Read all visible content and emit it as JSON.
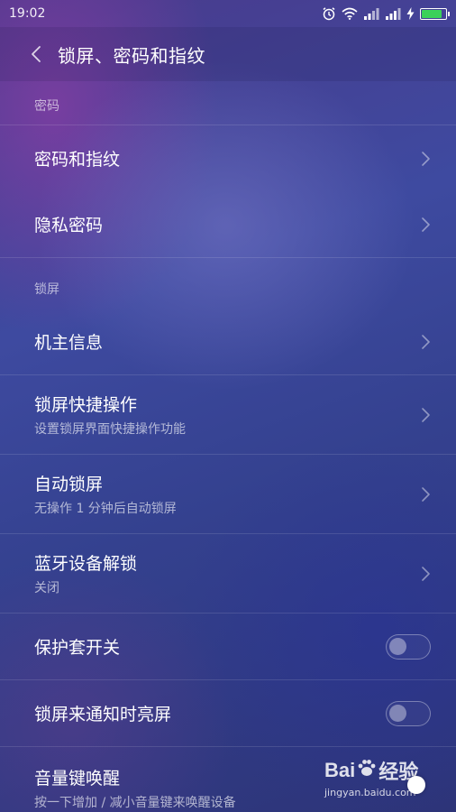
{
  "status_bar": {
    "time": "19:02",
    "icons": [
      "alarm-icon",
      "wifi-icon",
      "signal-icon",
      "signal-icon",
      "charging-icon",
      "battery-icon"
    ],
    "battery_color": "#3ad15a",
    "battery_level": 0.85
  },
  "header": {
    "back_icon": "chevron-left-icon",
    "title": "锁屏、密码和指纹"
  },
  "sections": {
    "password": {
      "label": "密码",
      "items": {
        "password_fingerprint": {
          "title": "密码和指纹"
        },
        "privacy_password": {
          "title": "隐私密码"
        }
      }
    },
    "lockscreen": {
      "label": "锁屏",
      "items": {
        "owner_info": {
          "title": "机主信息"
        },
        "shortcuts": {
          "title": "锁屏快捷操作",
          "subtitle": "设置锁屏界面快捷操作功能"
        },
        "auto_lock": {
          "title": "自动锁屏",
          "subtitle": "无操作 1 分钟后自动锁屏"
        },
        "bluetooth_unlock": {
          "title": "蓝牙设备解锁",
          "subtitle": "关闭"
        },
        "case_switch": {
          "title": "保护套开关",
          "toggle": false
        },
        "notification_wake": {
          "title": "锁屏来通知时亮屏",
          "toggle": false
        },
        "volume_wake": {
          "title": "音量键唤醒",
          "subtitle": "按一下增加 / 减小音量键来唤醒设备"
        }
      }
    }
  },
  "watermark": {
    "brand_left": "Bai",
    "brand_right": "经验",
    "url": "jingyan.baidu.com"
  }
}
